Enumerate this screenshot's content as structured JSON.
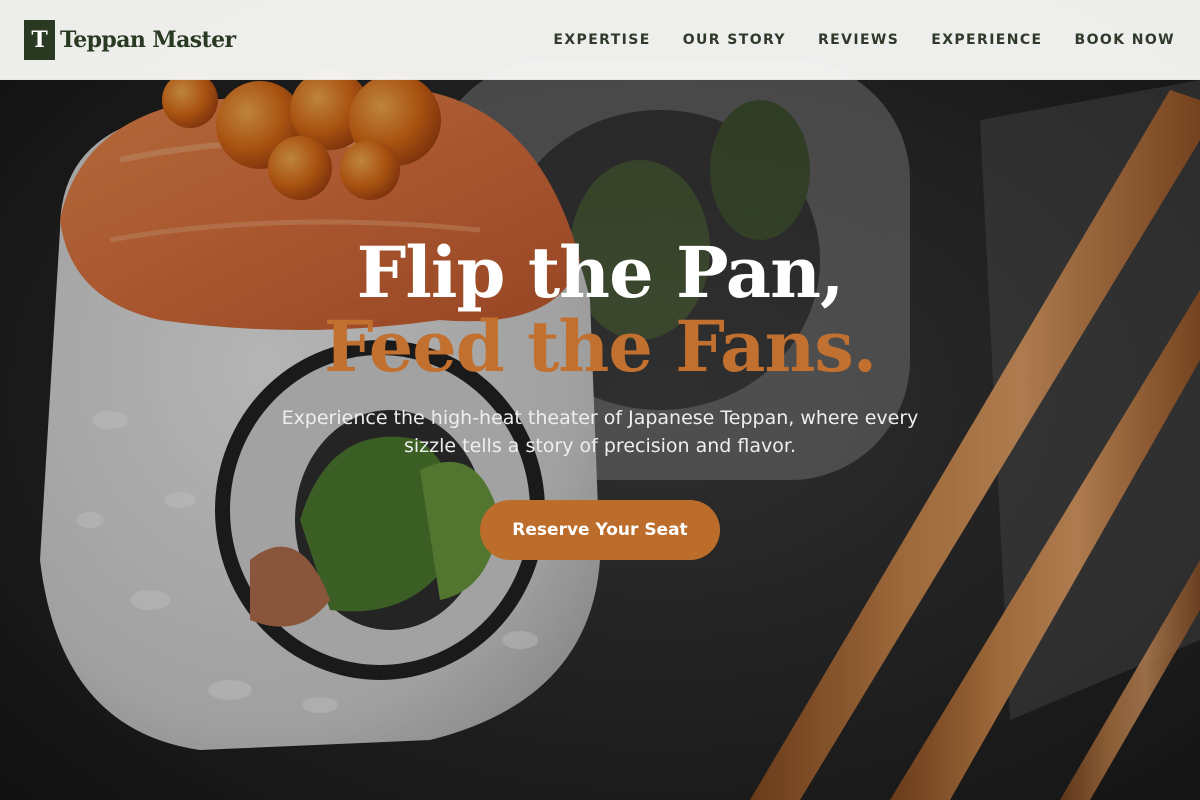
{
  "brand": {
    "logo_letter": "T",
    "name": "Teppan Master"
  },
  "nav": {
    "items": [
      {
        "label": "EXPERTISE"
      },
      {
        "label": "OUR STORY"
      },
      {
        "label": "REVIEWS"
      },
      {
        "label": "EXPERIENCE"
      },
      {
        "label": "BOOK NOW"
      }
    ]
  },
  "hero": {
    "headline_line1": "Flip the Pan,",
    "headline_line2": "Feed the Fans.",
    "subheadline": "Experience the high-heat theater of Japanese Teppan, where every sizzle tells a story of precision and flavor.",
    "cta_label": "Reserve Your Seat"
  },
  "colors": {
    "accent": "#c2702f",
    "button": "#bd6d2b",
    "brand_dark": "#2a3a22",
    "nav_background": "#f7f7f6"
  },
  "icons": {
    "logo": "letter-t-logo-icon"
  }
}
